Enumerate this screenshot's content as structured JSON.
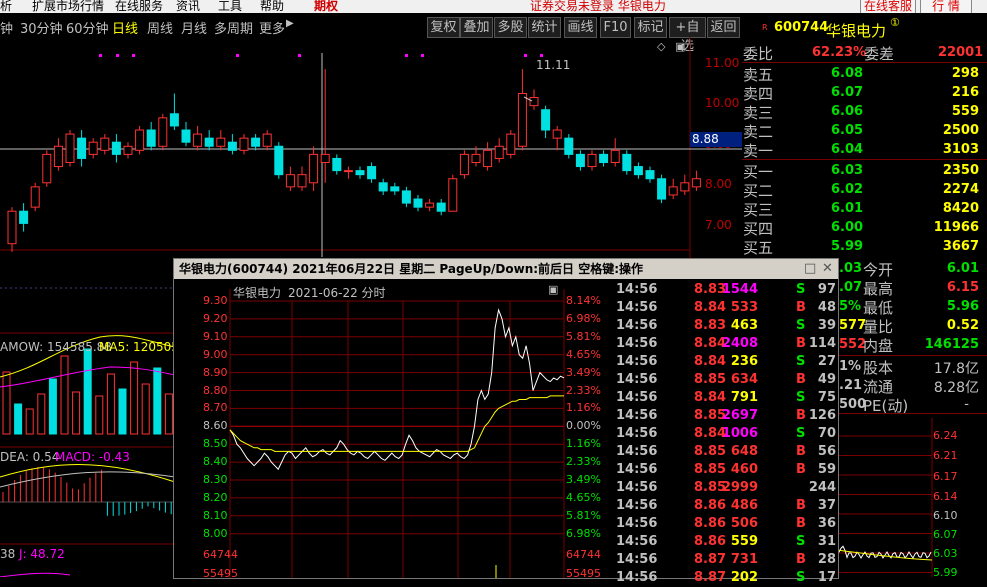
{
  "menu": {
    "left_items": [
      "析",
      "扩展市场行情",
      "在线服务",
      "资讯",
      "工具",
      "帮助"
    ],
    "period_tab": "期权",
    "status_text": "证券交易未登录 华银电力",
    "online_service": "在线客服",
    "quote_btn": "行 情"
  },
  "periods": [
    "钟",
    "30分钟",
    "60分钟",
    "日线",
    "周线",
    "月线",
    "多周期",
    "更多"
  ],
  "active_period": "日线",
  "toolbar": [
    "复权",
    "叠加",
    "多股",
    "统计",
    "画线",
    "F10",
    "标记",
    "+自选",
    "返回"
  ],
  "kline": {
    "price_labels": [
      "11.00",
      "10.00",
      "9.00",
      "8.00",
      "7.00"
    ],
    "current_price": "8.88",
    "peak_label": "11.11",
    "mavol_label": "AMOW: 154585.88",
    "ma5_label": "MA5: 120505.",
    "dea_label": "DEA: 0.54",
    "macd_label": "MACD: -0.43",
    "j_prefix": "38",
    "j_label": "J: 48.72",
    "candles": [
      {
        "o": 6.7,
        "c": 7.5,
        "h": 7.6,
        "l": 6.5
      },
      {
        "o": 7.5,
        "c": 7.2,
        "h": 7.7,
        "l": 7.0
      },
      {
        "o": 7.6,
        "c": 8.1,
        "h": 8.2,
        "l": 7.5
      },
      {
        "o": 8.2,
        "c": 8.9,
        "h": 9.0,
        "l": 8.1
      },
      {
        "o": 8.6,
        "c": 9.1,
        "h": 9.3,
        "l": 8.5
      },
      {
        "o": 8.7,
        "c": 9.4,
        "h": 9.5,
        "l": 8.6
      },
      {
        "o": 9.3,
        "c": 8.8,
        "h": 9.5,
        "l": 8.6
      },
      {
        "o": 8.9,
        "c": 9.2,
        "h": 9.3,
        "l": 8.8
      },
      {
        "o": 9.0,
        "c": 9.3,
        "h": 9.4,
        "l": 8.9
      },
      {
        "o": 9.2,
        "c": 8.9,
        "h": 9.4,
        "l": 8.7
      },
      {
        "o": 8.9,
        "c": 9.1,
        "h": 9.2,
        "l": 8.8
      },
      {
        "o": 9.0,
        "c": 9.5,
        "h": 9.6,
        "l": 8.9
      },
      {
        "o": 9.5,
        "c": 9.1,
        "h": 9.7,
        "l": 9.0
      },
      {
        "o": 9.1,
        "c": 9.8,
        "h": 9.9,
        "l": 9.0
      },
      {
        "o": 9.9,
        "c": 9.6,
        "h": 10.4,
        "l": 9.5
      },
      {
        "o": 9.5,
        "c": 9.2,
        "h": 9.7,
        "l": 9.1
      },
      {
        "o": 9.1,
        "c": 9.4,
        "h": 9.6,
        "l": 9.0
      },
      {
        "o": 9.3,
        "c": 9.1,
        "h": 9.5,
        "l": 9.0
      },
      {
        "o": 9.1,
        "c": 9.3,
        "h": 9.5,
        "l": 9.0
      },
      {
        "o": 9.2,
        "c": 9.0,
        "h": 9.4,
        "l": 8.9
      },
      {
        "o": 9.0,
        "c": 9.3,
        "h": 9.4,
        "l": 8.9
      },
      {
        "o": 9.3,
        "c": 9.1,
        "h": 9.4,
        "l": 9.0
      },
      {
        "o": 9.1,
        "c": 9.4,
        "h": 9.5,
        "l": 9.0
      },
      {
        "o": 9.1,
        "c": 8.4,
        "h": 9.2,
        "l": 8.3
      },
      {
        "o": 8.1,
        "c": 8.4,
        "h": 8.6,
        "l": 8.0
      },
      {
        "o": 8.1,
        "c": 8.4,
        "h": 8.6,
        "l": 8.0
      },
      {
        "o": 8.2,
        "c": 8.9,
        "h": 9.1,
        "l": 8.0
      },
      {
        "o": 8.7,
        "c": 8.9,
        "h": 11.0,
        "l": 8.2
      },
      {
        "o": 8.8,
        "c": 8.5,
        "h": 8.9,
        "l": 8.4
      },
      {
        "o": 8.5,
        "c": 8.5,
        "h": 8.6,
        "l": 8.3
      },
      {
        "o": 8.5,
        "c": 8.4,
        "h": 8.6,
        "l": 8.3
      },
      {
        "o": 8.6,
        "c": 8.3,
        "h": 8.7,
        "l": 8.2
      },
      {
        "o": 8.2,
        "c": 8.0,
        "h": 8.3,
        "l": 7.9
      },
      {
        "o": 8.1,
        "c": 8.0,
        "h": 8.2,
        "l": 7.9
      },
      {
        "o": 8.0,
        "c": 7.7,
        "h": 8.1,
        "l": 7.6
      },
      {
        "o": 7.8,
        "c": 7.6,
        "h": 7.9,
        "l": 7.5
      },
      {
        "o": 7.6,
        "c": 7.7,
        "h": 7.8,
        "l": 7.5
      },
      {
        "o": 7.7,
        "c": 7.5,
        "h": 7.8,
        "l": 7.4
      },
      {
        "o": 7.5,
        "c": 8.3,
        "h": 8.4,
        "l": 7.5
      },
      {
        "o": 8.4,
        "c": 8.9,
        "h": 9.0,
        "l": 8.3
      },
      {
        "o": 8.7,
        "c": 8.9,
        "h": 9.1,
        "l": 8.6
      },
      {
        "o": 8.6,
        "c": 9.0,
        "h": 9.2,
        "l": 8.5
      },
      {
        "o": 8.8,
        "c": 9.1,
        "h": 9.3,
        "l": 8.7
      },
      {
        "o": 8.9,
        "c": 9.4,
        "h": 9.5,
        "l": 8.8
      },
      {
        "o": 9.1,
        "c": 10.4,
        "h": 11.0,
        "l": 9.0
      },
      {
        "o": 10.1,
        "c": 10.3,
        "h": 10.5,
        "l": 10.0
      },
      {
        "o": 10.0,
        "c": 9.5,
        "h": 10.1,
        "l": 9.3
      },
      {
        "o": 9.3,
        "c": 9.5,
        "h": 9.6,
        "l": 9.0
      },
      {
        "o": 9.3,
        "c": 8.9,
        "h": 9.4,
        "l": 8.8
      },
      {
        "o": 8.9,
        "c": 8.6,
        "h": 9.0,
        "l": 8.5
      },
      {
        "o": 8.6,
        "c": 8.9,
        "h": 9.0,
        "l": 8.5
      },
      {
        "o": 8.9,
        "c": 8.7,
        "h": 9.0,
        "l": 8.6
      },
      {
        "o": 8.7,
        "c": 9.0,
        "h": 9.3,
        "l": 8.6
      },
      {
        "o": 8.9,
        "c": 8.5,
        "h": 9.0,
        "l": 8.4
      },
      {
        "o": 8.6,
        "c": 8.4,
        "h": 8.7,
        "l": 8.3
      },
      {
        "o": 8.5,
        "c": 8.3,
        "h": 8.6,
        "l": 8.2
      },
      {
        "o": 8.3,
        "c": 7.8,
        "h": 8.4,
        "l": 7.7
      },
      {
        "o": 7.9,
        "c": 8.1,
        "h": 8.3,
        "l": 7.8
      },
      {
        "o": 8.0,
        "c": 8.2,
        "h": 8.4,
        "l": 7.9
      },
      {
        "o": 8.1,
        "c": 8.3,
        "h": 8.5,
        "l": 8.0
      }
    ]
  },
  "quote": {
    "r_mark": "R",
    "code": "600744",
    "name": "华银电力",
    "circle": "①",
    "webi_label": "委比",
    "webi_value": "62.23%",
    "wecha_label": "委差",
    "wecha_value": "22001",
    "asks": [
      {
        "label": "卖五",
        "price": "6.08",
        "vol": "298"
      },
      {
        "label": "卖四",
        "price": "6.07",
        "vol": "216"
      },
      {
        "label": "卖三",
        "price": "6.06",
        "vol": "559"
      },
      {
        "label": "卖二",
        "price": "6.05",
        "vol": "2500"
      },
      {
        "label": "卖一",
        "price": "6.04",
        "vol": "3103"
      }
    ],
    "bids": [
      {
        "label": "买一",
        "price": "6.03",
        "vol": "2350"
      },
      {
        "label": "买二",
        "price": "6.02",
        "vol": "2274"
      },
      {
        "label": "买三",
        "price": "6.01",
        "vol": "8420"
      },
      {
        "label": "买四",
        "price": "6.00",
        "vol": "11966"
      },
      {
        "label": "买五",
        "price": "5.99",
        "vol": "3667"
      }
    ],
    "stats": [
      {
        "pre": ".03",
        "label": "今开",
        "value": "6.01"
      },
      {
        "pre": ".07",
        "label": "最高",
        "value": "6.15"
      },
      {
        "pre": "5%",
        "label": "最低",
        "value": "5.96"
      },
      {
        "pre": "577",
        "label": "量比",
        "value": "0.52"
      },
      {
        "pre": "552",
        "label": "内盘",
        "value": "146125"
      }
    ],
    "equity": [
      {
        "pre": "1%",
        "label": "股本",
        "value": "17.8亿"
      },
      {
        "pre": ".21",
        "label": "流通",
        "value": "8.28亿"
      },
      {
        "pre": "500",
        "label": "PE(动)",
        "value": "-"
      }
    ],
    "mini_axis": [
      "6.24",
      "6.21",
      "6.17",
      "6.14",
      "6.10",
      "6.07",
      "6.03",
      "5.99"
    ]
  },
  "popup": {
    "title": "华银电力(600744)  2021年06月22日 星期二  PageUp/Down:前后日 空格键:操作",
    "chart_name": "华银电力",
    "chart_date": "2021-06-22 分时",
    "max_icon": "□",
    "close_icon": "✕",
    "left_axis": [
      "9.30",
      "9.20",
      "9.10",
      "9.00",
      "8.90",
      "8.80",
      "8.70",
      "8.60",
      "8.50",
      "8.40",
      "8.30",
      "8.20",
      "8.10",
      "8.00"
    ],
    "right_axis": [
      "8.14%",
      "6.98%",
      "5.81%",
      "4.65%",
      "3.49%",
      "2.33%",
      "1.16%",
      "0.00%",
      "1.16%",
      "2.33%",
      "3.49%",
      "4.65%",
      "5.81%",
      "6.98%"
    ],
    "vol_labels": [
      "64744",
      "55495"
    ],
    "base_price": 8.6,
    "trades": [
      {
        "time": "14:56",
        "price": "8.83",
        "vol": "1544",
        "bs": "S",
        "n": "97"
      },
      {
        "time": "14:56",
        "price": "8.84",
        "vol": "533",
        "bs": "B",
        "n": "48"
      },
      {
        "time": "14:56",
        "price": "8.83",
        "vol": "463",
        "bs": "S",
        "n": "39"
      },
      {
        "time": "14:56",
        "price": "8.84",
        "vol": "2408",
        "bs": "B",
        "n": "114"
      },
      {
        "time": "14:56",
        "price": "8.84",
        "vol": "236",
        "bs": "S",
        "n": "27"
      },
      {
        "time": "14:56",
        "price": "8.85",
        "vol": "634",
        "bs": "B",
        "n": "49"
      },
      {
        "time": "14:56",
        "price": "8.84",
        "vol": "791",
        "bs": "S",
        "n": "75"
      },
      {
        "time": "14:56",
        "price": "8.85",
        "vol": "2697",
        "bs": "B",
        "n": "126"
      },
      {
        "time": "14:56",
        "price": "8.84",
        "vol": "1006",
        "bs": "S",
        "n": "70"
      },
      {
        "time": "14:56",
        "price": "8.85",
        "vol": "648",
        "bs": "B",
        "n": "56"
      },
      {
        "time": "14:56",
        "price": "8.85",
        "vol": "460",
        "bs": "B",
        "n": "59"
      },
      {
        "time": "14:56",
        "price": "8.85",
        "vol": "2999",
        "bs": "",
        "n": "244"
      },
      {
        "time": "14:56",
        "price": "8.86",
        "vol": "486",
        "bs": "B",
        "n": "37"
      },
      {
        "time": "14:56",
        "price": "8.86",
        "vol": "506",
        "bs": "B",
        "n": "36"
      },
      {
        "time": "14:56",
        "price": "8.86",
        "vol": "559",
        "bs": "S",
        "n": "31"
      },
      {
        "time": "14:56",
        "price": "8.87",
        "vol": "731",
        "bs": "B",
        "n": "28"
      },
      {
        "time": "14:56",
        "price": "8.87",
        "vol": "202",
        "bs": "S",
        "n": "17"
      }
    ],
    "intraday_price": [
      8.58,
      8.55,
      8.5,
      8.48,
      8.45,
      8.42,
      8.4,
      8.38,
      8.4,
      8.42,
      8.45,
      8.43,
      8.4,
      8.38,
      8.36,
      8.4,
      8.44,
      8.46,
      8.45,
      8.42,
      8.44,
      8.46,
      8.48,
      8.45,
      8.43,
      8.44,
      8.46,
      8.47,
      8.45,
      8.44,
      8.46,
      8.48,
      8.52,
      8.5,
      8.47,
      8.45,
      8.44,
      8.46,
      8.45,
      8.43,
      8.42,
      8.44,
      8.46,
      8.44,
      8.42,
      8.41,
      8.43,
      8.45,
      8.43,
      8.42,
      8.44,
      8.5,
      8.55,
      8.52,
      8.48,
      8.46,
      8.45,
      8.44,
      8.43,
      8.45,
      8.47,
      8.46,
      8.44,
      8.43,
      8.42,
      8.44,
      8.45,
      8.43,
      8.42,
      8.44,
      8.5,
      8.6,
      8.75,
      8.8,
      8.75,
      8.78,
      8.9,
      9.15,
      9.25,
      9.2,
      9.1,
      9.15,
      9.05,
      9.1,
      9.0,
      8.98,
      9.05,
      8.95,
      8.8,
      8.85,
      8.9,
      8.88,
      8.86,
      8.85,
      8.87,
      8.86,
      8.88,
      8.87
    ],
    "intraday_avg": [
      8.58,
      8.56,
      8.54,
      8.52,
      8.51,
      8.5,
      8.49,
      8.48,
      8.48,
      8.47,
      8.47,
      8.47,
      8.47,
      8.46,
      8.46,
      8.46,
      8.46,
      8.46,
      8.46,
      8.46,
      8.46,
      8.46,
      8.46,
      8.46,
      8.46,
      8.46,
      8.46,
      8.46,
      8.46,
      8.46,
      8.46,
      8.46,
      8.46,
      8.46,
      8.46,
      8.46,
      8.46,
      8.46,
      8.46,
      8.46,
      8.46,
      8.46,
      8.46,
      8.46,
      8.46,
      8.46,
      8.46,
      8.46,
      8.46,
      8.46,
      8.46,
      8.46,
      8.46,
      8.46,
      8.46,
      8.46,
      8.46,
      8.46,
      8.46,
      8.46,
      8.46,
      8.46,
      8.46,
      8.46,
      8.46,
      8.46,
      8.46,
      8.46,
      8.46,
      8.46,
      8.47,
      8.48,
      8.52,
      8.56,
      8.6,
      8.62,
      8.65,
      8.68,
      8.7,
      8.71,
      8.72,
      8.73,
      8.74,
      8.74,
      8.75,
      8.75,
      8.75,
      8.76,
      8.76,
      8.76,
      8.76,
      8.76,
      8.76,
      8.77,
      8.77,
      8.77,
      8.77,
      8.77
    ]
  },
  "colors": {
    "up": "#ff3232",
    "down": "#00e0e0",
    "grid": "#7a0000",
    "yellow": "#ffff00",
    "green": "#00e000",
    "magenta": "#ff00ff"
  }
}
